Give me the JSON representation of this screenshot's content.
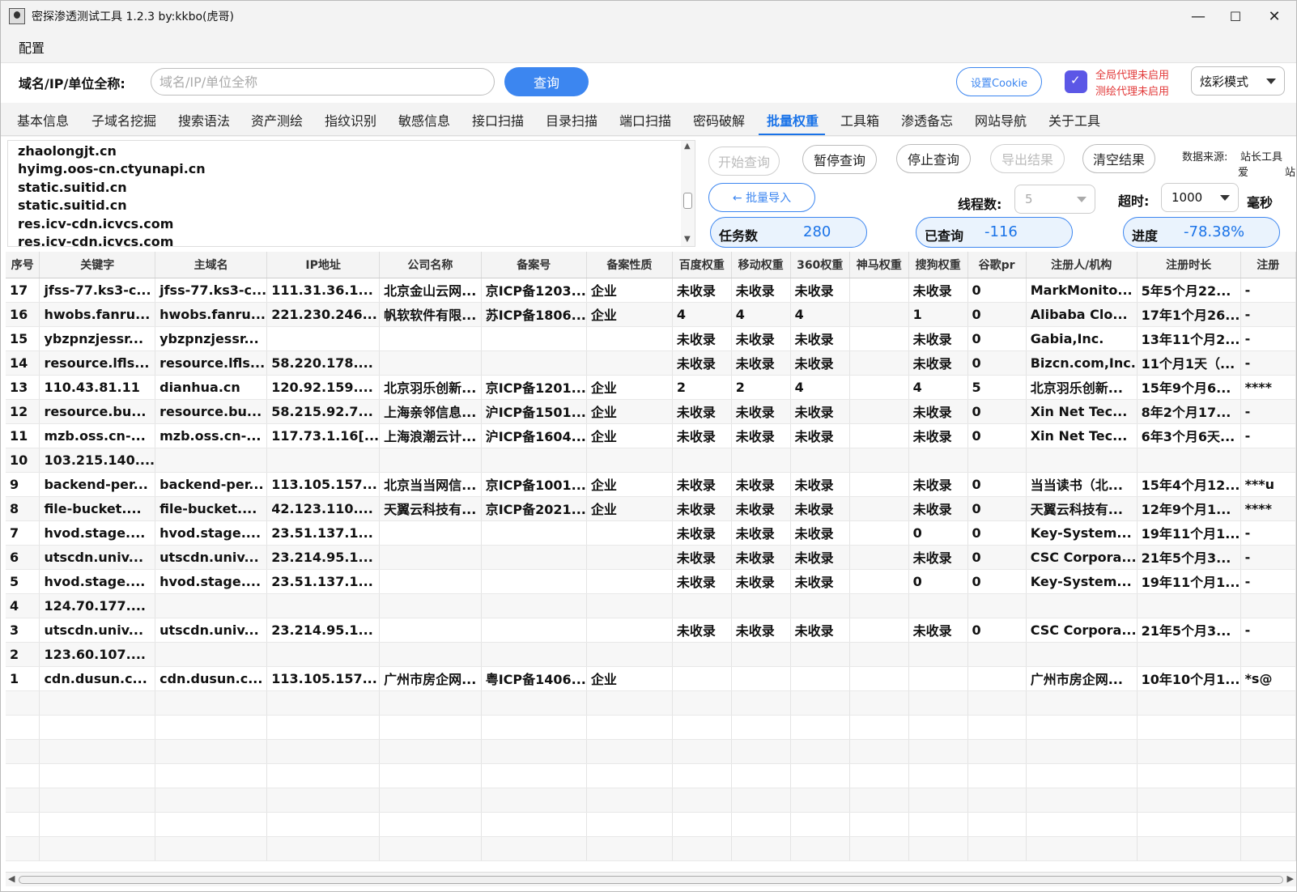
{
  "window": {
    "title": "密探渗透测试工具 1.2.3 by:kkbo(虎哥)",
    "minimize": "—",
    "maximize": "☐",
    "close": "✕"
  },
  "menu": {
    "config": "配置"
  },
  "search": {
    "label": "域名/IP/单位全称:",
    "placeholder": "域名/IP/单位全称",
    "query_button": "查询",
    "cookie_button": "设置Cookie",
    "proxy_global": "全局代理未启用",
    "proxy_map": "测绘代理未启用",
    "mode": "炫彩模式"
  },
  "tabs": [
    "基本信息",
    "子域名挖掘",
    "搜索语法",
    "资产测绘",
    "指纹识别",
    "敏感信息",
    "接口扫描",
    "目录扫描",
    "端口扫描",
    "密码破解",
    "批量权重",
    "工具箱",
    "渗透备忘",
    "网站导航",
    "关于工具"
  ],
  "active_tab": "批量权重",
  "domain_list": [
    "zhaolongjt.cn",
    "hyimg.oos-cn.ctyunapi.cn",
    "static.suitid.cn",
    "static.suitid.cn",
    "res.icv-cdn.icvcs.com",
    "res.icv-cdn.icvcs.com"
  ],
  "controls": {
    "start": "开始查询",
    "pause": "暂停查询",
    "stop": "停止查询",
    "export": "导出结果",
    "clear": "清空结果",
    "batch_import": "← 批量导入",
    "source_label": "数据来源:",
    "source_1": "站长工具",
    "source_2": "爱",
    "source_3": "站",
    "thread_label": "线程数:",
    "thread_value": "5",
    "timeout_label": "超时:",
    "timeout_value": "1000",
    "ms_label": "毫秒"
  },
  "stats": {
    "tasks_label": "任务数",
    "tasks_value": "280",
    "queried_label": "已查询",
    "queried_value": "-116",
    "progress_label": "进度",
    "progress_value": "-78.38%"
  },
  "table": {
    "headers": [
      "序号",
      "关键字",
      "主域名",
      "IP地址",
      "公司名称",
      "备案号",
      "备案性质",
      "百度权重",
      "移动权重",
      "360权重",
      "神马权重",
      "搜狗权重",
      "谷歌pr",
      "注册人/机构",
      "注册时长",
      "注册"
    ],
    "rows": [
      [
        "17",
        "jfss-77.ks3-c...",
        "jfss-77.ks3-c...",
        "111.31.36.1...",
        "北京金山云网...",
        "京ICP备1203...",
        "企业",
        "未收录",
        "未收录",
        "未收录",
        "",
        "未收录",
        "0",
        "MarkMonito...",
        "5年5个月22...",
        "-"
      ],
      [
        "16",
        "hwobs.fanru...",
        "hwobs.fanru...",
        "221.230.246...",
        "帆软软件有限...",
        "苏ICP备1806...",
        "企业",
        "4",
        "4",
        "4",
        "",
        "1",
        "0",
        "Alibaba Clo...",
        "17年1个月26...",
        "-"
      ],
      [
        "15",
        "ybzpnzjessr...",
        "ybzpnzjessr...",
        "",
        "",
        "",
        "",
        "未收录",
        "未收录",
        "未收录",
        "",
        "未收录",
        "0",
        "Gabia,Inc.",
        "13年11个月2...",
        "-"
      ],
      [
        "14",
        "resource.lfls...",
        "resource.lfls...",
        "58.220.178....",
        "",
        "",
        "",
        "未收录",
        "未收录",
        "未收录",
        "",
        "未收录",
        "0",
        "Bizcn.com,Inc.",
        "11个月1天（...",
        "-"
      ],
      [
        "13",
        "110.43.81.11",
        "dianhua.cn",
        "120.92.159....",
        "北京羽乐创新...",
        "京ICP备1201...",
        "企业",
        "2",
        "2",
        "4",
        "",
        "4",
        "5",
        "北京羽乐创新...",
        "15年9个月6...",
        "****"
      ],
      [
        "12",
        "resource.bu...",
        "resource.bu...",
        "58.215.92.7...",
        "上海亲邻信息...",
        "沪ICP备1501...",
        "企业",
        "未收录",
        "未收录",
        "未收录",
        "",
        "未收录",
        "0",
        "Xin Net Tec...",
        "8年2个月17...",
        "-"
      ],
      [
        "11",
        "mzb.oss.cn-...",
        "mzb.oss.cn-...",
        "117.73.1.16[...",
        "上海浪潮云计...",
        "沪ICP备1604...",
        "企业",
        "未收录",
        "未收录",
        "未收录",
        "",
        "未收录",
        "0",
        "Xin Net Tec...",
        "6年3个月6天...",
        "-"
      ],
      [
        "10",
        "103.215.140....",
        "",
        "",
        "",
        "",
        "",
        "",
        "",
        "",
        "",
        "",
        "",
        "",
        "",
        ""
      ],
      [
        "9",
        "backend-per...",
        "backend-per...",
        "113.105.157...",
        "北京当当网信...",
        "京ICP备1001...",
        "企业",
        "未收录",
        "未收录",
        "未收录",
        "",
        "未收录",
        "0",
        "当当读书（北...",
        "15年4个月12...",
        "***u"
      ],
      [
        "8",
        "file-bucket....",
        "file-bucket....",
        "42.123.110....",
        "天翼云科技有...",
        "京ICP备2021...",
        "企业",
        "未收录",
        "未收录",
        "未收录",
        "",
        "未收录",
        "0",
        "天翼云科技有...",
        "12年9个月1...",
        "****"
      ],
      [
        "7",
        "hvod.stage....",
        "hvod.stage....",
        "23.51.137.1...",
        "",
        "",
        "",
        "未收录",
        "未收录",
        "未收录",
        "",
        "0",
        "0",
        "Key-System...",
        "19年11个月1...",
        "-"
      ],
      [
        "6",
        "utscdn.univ...",
        "utscdn.univ...",
        "23.214.95.1...",
        "",
        "",
        "",
        "未收录",
        "未收录",
        "未收录",
        "",
        "未收录",
        "0",
        "CSC Corpora...",
        "21年5个月3...",
        "-"
      ],
      [
        "5",
        "hvod.stage....",
        "hvod.stage....",
        "23.51.137.1...",
        "",
        "",
        "",
        "未收录",
        "未收录",
        "未收录",
        "",
        "0",
        "0",
        "Key-System...",
        "19年11个月1...",
        "-"
      ],
      [
        "4",
        "124.70.177....",
        "",
        "",
        "",
        "",
        "",
        "",
        "",
        "",
        "",
        "",
        "",
        "",
        "",
        ""
      ],
      [
        "3",
        "utscdn.univ...",
        "utscdn.univ...",
        "23.214.95.1...",
        "",
        "",
        "",
        "未收录",
        "未收录",
        "未收录",
        "",
        "未收录",
        "0",
        "CSC Corpora...",
        "21年5个月3...",
        "-"
      ],
      [
        "2",
        "123.60.107....",
        "",
        "",
        "",
        "",
        "",
        "",
        "",
        "",
        "",
        "",
        "",
        "",
        "",
        ""
      ],
      [
        "1",
        "cdn.dusun.c...",
        "cdn.dusun.c...",
        "113.105.157...",
        "广州市房企网...",
        "粤ICP备1406...",
        "企业",
        "",
        "",
        "",
        "",
        "",
        "",
        "广州市房企网...",
        "10年10个月1...",
        "*s@"
      ]
    ]
  },
  "colors": {
    "accent": "#3c86f0",
    "active_tab": "#1a73e8",
    "proxy_warning": "#e23a3a",
    "shield": "#5b57e6"
  },
  "icons": {
    "app": "spy-avatar-icon",
    "shield": "shield-check-icon"
  }
}
